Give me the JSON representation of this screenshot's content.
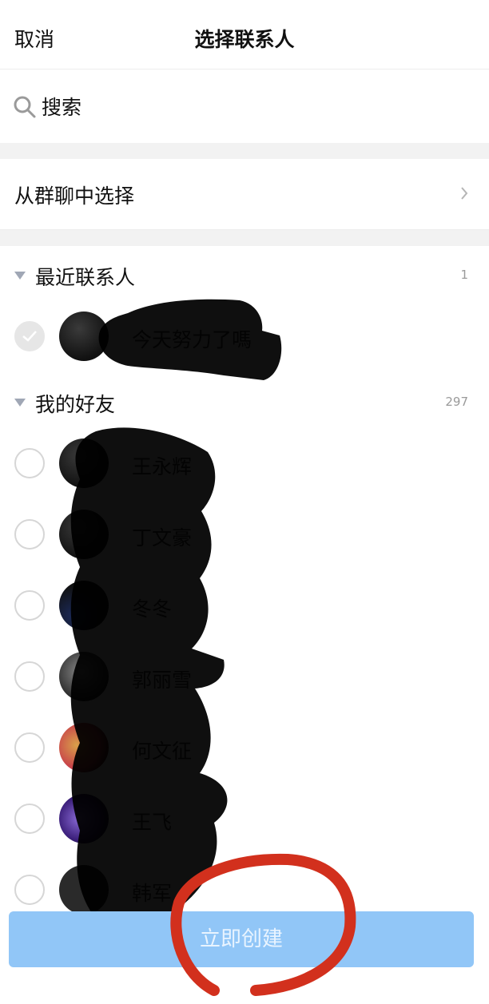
{
  "header": {
    "cancel_label": "取消",
    "title": "选择联系人"
  },
  "search": {
    "placeholder": "搜索"
  },
  "group_chat": {
    "label": "从群聊中选择"
  },
  "recent": {
    "label": "最近联系人",
    "count": "1",
    "items": [
      {
        "name": "今天努力了嗎",
        "checked": true
      }
    ]
  },
  "friends": {
    "label": "我的好友",
    "count": "297",
    "items": [
      {
        "name": "王永辉",
        "checked": false
      },
      {
        "name": "丁文豪",
        "checked": false
      },
      {
        "name": "冬冬",
        "checked": false
      },
      {
        "name": "郭丽雪",
        "checked": false
      },
      {
        "name": "何文征",
        "checked": false
      },
      {
        "name": "王飞",
        "checked": false
      },
      {
        "name": "韩军",
        "checked": false
      }
    ]
  },
  "footer": {
    "create_label": "立即创建"
  },
  "colors": {
    "accent_disabled": "#91c6f7",
    "annotation_red": "#d2301d"
  }
}
